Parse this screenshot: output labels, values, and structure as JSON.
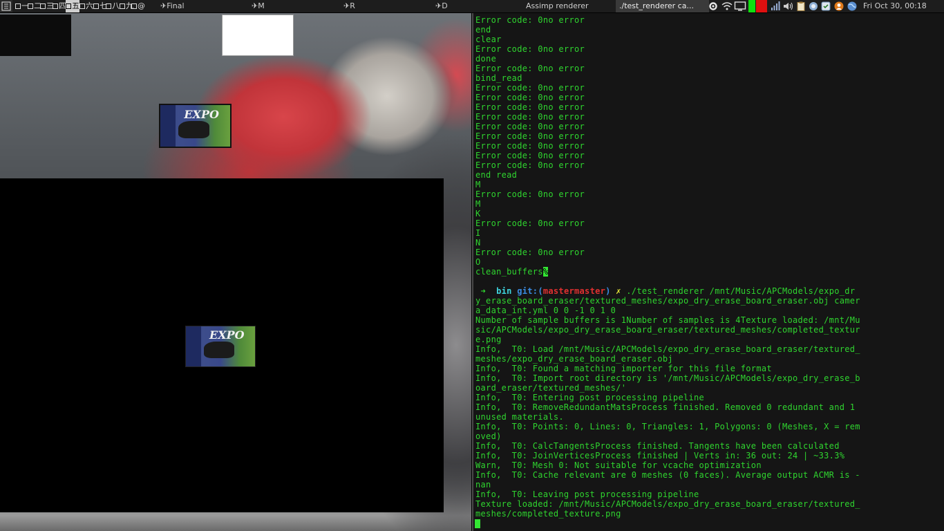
{
  "topbar": {
    "workspaces": [
      "一",
      "二",
      "三",
      "四",
      "五",
      "六",
      "七",
      "八",
      "九",
      "@"
    ],
    "active_workspace": 4,
    "tasks": [
      {
        "label": "✈Final"
      },
      {
        "label": "✈M"
      },
      {
        "label": "✈R"
      },
      {
        "label": "✈D"
      },
      {
        "label": "Assimp renderer"
      },
      {
        "label": "./test_renderer  ca..."
      }
    ],
    "tray_icons": [
      "settings-icon",
      "wifi-icon",
      "monitor-icon",
      "cpu-graph-icon",
      "memory-graph-icon",
      "signal-icon",
      "volume-icon",
      "clipboard-icon",
      "network-icon",
      "update-icon",
      "user-icon",
      "globe-icon"
    ],
    "clock": "Fri Oct 30, 00:18"
  },
  "terminal": {
    "lines_before_prompt": [
      "Error code: 0no error",
      "end",
      "clear",
      "Error code: 0no error",
      "done",
      "Error code: 0no error",
      "bind_read",
      "Error code: 0no error",
      "Error code: 0no error",
      "Error code: 0no error",
      "Error code: 0no error",
      "Error code: 0no error",
      "Error code: 0no error",
      "Error code: 0no error",
      "Error code: 0no error",
      "Error code: 0no error",
      "end read",
      "M",
      "Error code: 0no error",
      "M",
      "K",
      "Error code: 0no error",
      "I",
      "N",
      "Error code: 0no error",
      "O"
    ],
    "last_output": "clean_buffers",
    "last_output_cursor": "%",
    "prompt": {
      "arrow": "➜",
      "dir": "bin",
      "git_label": "git:(",
      "branch": "mastermaster",
      "git_close": ")",
      "dirty": "✗",
      "command": "./test_renderer /mnt/Music/APCModels/expo_dry_erase_board_eraser/textured_meshes/expo_dry_erase_board_eraser.obj camera_data_int.yml 0 0 -1 0 1 0"
    },
    "output_lines": [
      "Number of sample buffers is 1Number of samples is 4Texture loaded: /mnt/Music/APCModels/expo_dry_erase_board_eraser/textured_meshes/completed_texture.png",
      "Info,  T0: Load /mnt/Music/APCModels/expo_dry_erase_board_eraser/textured_meshes/expo_dry_erase_board_eraser.obj",
      "Info,  T0: Found a matching importer for this file format",
      "Info,  T0: Import root directory is '/mnt/Music/APCModels/expo_dry_erase_board_eraser/textured_meshes/'",
      "Info,  T0: Entering post processing pipeline",
      "Info,  T0: RemoveRedundantMatsProcess finished. Removed 0 redundant and 1 unused materials.",
      "Info,  T0: Points: 0, Lines: 0, Triangles: 1, Polygons: 0 (Meshes, X = removed)",
      "Info,  T0: CalcTangentsProcess finished. Tangents have been calculated",
      "Info,  T0: JoinVerticesProcess finished | Verts in: 36 out: 24 | ~33.3%",
      "Warn,  T0: Mesh 0: Not suitable for vcache optimization",
      "Info,  T0: Cache relevant are 0 meshes (0 faces). Average output ACMR is -nan",
      "Info,  T0: Leaving post processing pipeline",
      "Texture loaded: /mnt/Music/APCModels/expo_dry_erase_board_eraser/textured_meshes/completed_texture.png"
    ]
  },
  "eraser_label": {
    "brand": "EXPO"
  }
}
